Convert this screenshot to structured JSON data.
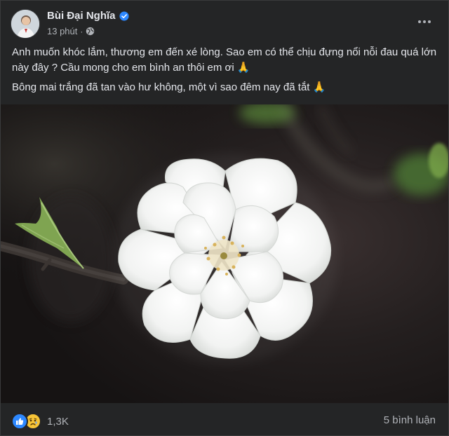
{
  "post": {
    "author": "Bùi Đại Nghĩa",
    "time": "13 phút",
    "separator": "·",
    "icons": {
      "verified": "verified-badge-icon",
      "audience": "globe-icon",
      "more": "more-options-icon"
    },
    "text_lines": [
      "Anh muốn khóc lắm, thương em đến xé lòng. Sao em có thể chịu đựng nổi nỗi đau quá lớn này đây ? Cầu mong cho em bình an thôi em ơi",
      "Bông mai trắng đã tan vào hư không, một vì sao đêm nay đã tắt"
    ],
    "emoji": "🙏"
  },
  "footer": {
    "reactions": [
      "like",
      "sad"
    ],
    "reaction_count": "1,3K",
    "comments": "5 bình luận"
  },
  "colors": {
    "background": "#242526",
    "text_primary": "#e4e6eb",
    "text_secondary": "#b0b3b8",
    "accent": "#2d88ff"
  }
}
